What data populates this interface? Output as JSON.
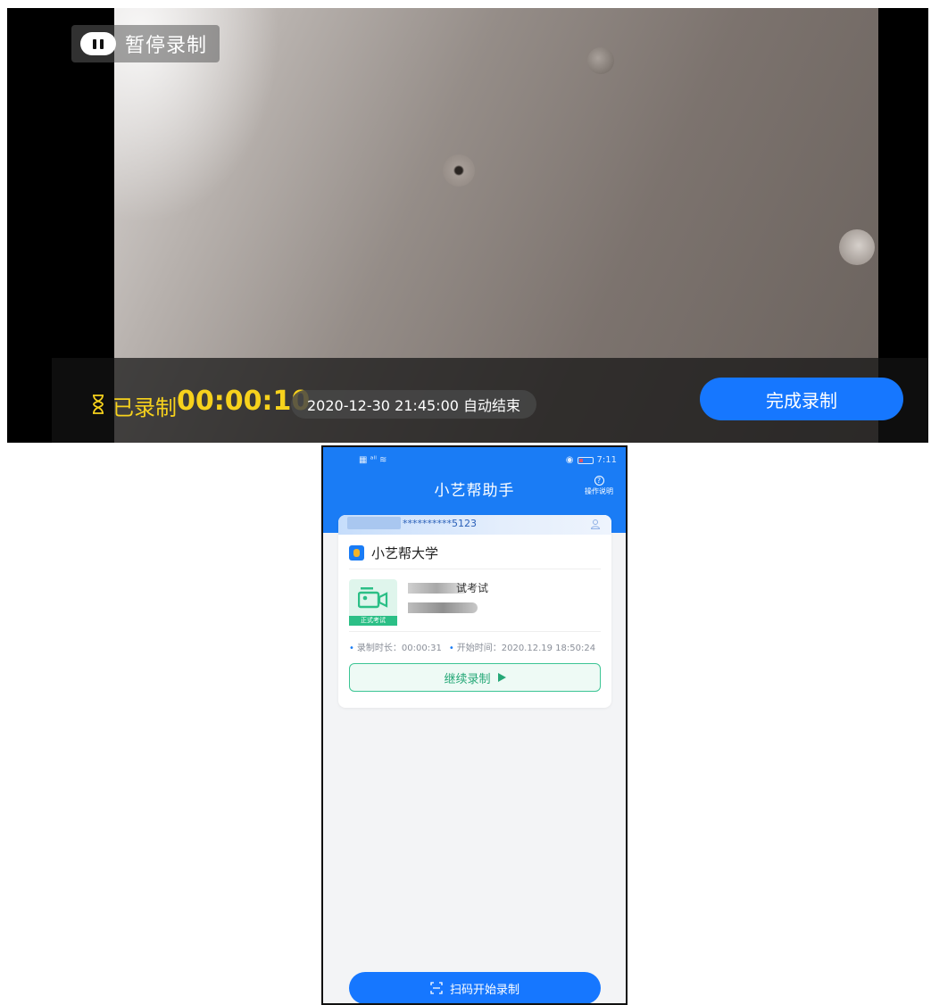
{
  "recording_screen": {
    "pause_label": "暂停录制",
    "recorded_label": "已录制",
    "recorded_time": "00:00:10",
    "auto_end_text": "2020-12-30 21:45:00 自动结束",
    "finish_button": "完成录制",
    "colors": {
      "timer": "#f7d21c",
      "accent": "#1677ff"
    }
  },
  "phone_screen": {
    "status_bar": {
      "time": "7:11"
    },
    "title": "小艺帮助手",
    "help_label": "操作说明",
    "account_masked": "**********5123",
    "school_name": "小艺帮大学",
    "exam": {
      "title_fragment": "试考试",
      "tag": "正式考试"
    },
    "record_duration": "录制时长：00:00:31",
    "start_time": "开始时间：2020.12.19 18:50:24",
    "continue_button": "继续录制",
    "scan_button": "扫码开始录制",
    "colors": {
      "header": "#1a7cf5",
      "success": "#2bbf86"
    }
  }
}
